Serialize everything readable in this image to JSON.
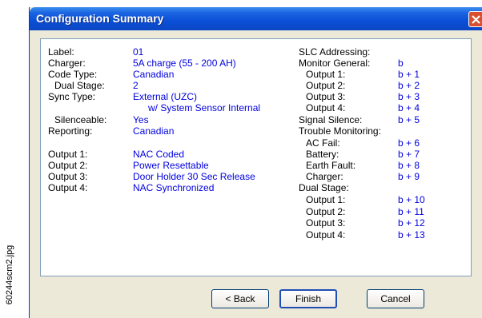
{
  "side_caption": "60244scm2.jpg",
  "window": {
    "title": "Configuration Summary"
  },
  "left_items": [
    {
      "label": "Label:",
      "value": "01"
    },
    {
      "label": "Charger:",
      "value": "5A charge (55 - 200 AH)"
    },
    {
      "label": "Code Type:",
      "value": "Canadian"
    },
    {
      "label": "Dual Stage:",
      "value": "2"
    },
    {
      "label": "Sync Type:",
      "value": "External (UZC)"
    },
    {
      "label": "",
      "value": "w/ System Sensor Internal"
    },
    {
      "label": "Silenceable:",
      "value": "Yes"
    },
    {
      "label": "Reporting:",
      "value": "Canadian"
    },
    {
      "label": "Output 1:",
      "value": "NAC Coded"
    },
    {
      "label": "Output 2:",
      "value": "Power Resettable"
    },
    {
      "label": "Output 3:",
      "value": "Door Holder 30 Sec Release"
    },
    {
      "label": "Output 4:",
      "value": "NAC Synchronized"
    }
  ],
  "right_items": [
    {
      "label": "SLC Addressing:",
      "value": ""
    },
    {
      "label": "Monitor General:",
      "value": "b"
    },
    {
      "label": "Output 1:",
      "value": "b + 1"
    },
    {
      "label": "Output 2:",
      "value": "b + 2"
    },
    {
      "label": "Output 3:",
      "value": "b + 3"
    },
    {
      "label": "Output 4:",
      "value": "b + 4"
    },
    {
      "label": "Signal Silence:",
      "value": "b + 5"
    },
    {
      "label": "Trouble Monitoring:",
      "value": ""
    },
    {
      "label": "AC Fail:",
      "value": "b + 6"
    },
    {
      "label": "Battery:",
      "value": "b + 7"
    },
    {
      "label": "Earth Fault:",
      "value": "b + 8"
    },
    {
      "label": "Charger:",
      "value": "b + 9"
    },
    {
      "label": "Dual Stage:",
      "value": ""
    },
    {
      "label": "Output 1:",
      "value": "b + 10"
    },
    {
      "label": "Output 2:",
      "value": "b + 11"
    },
    {
      "label": "Output 3:",
      "value": "b + 12"
    },
    {
      "label": "Output 4:",
      "value": "b + 13"
    }
  ],
  "buttons": {
    "back": "< Back",
    "finish": "Finish",
    "cancel": "Cancel"
  }
}
